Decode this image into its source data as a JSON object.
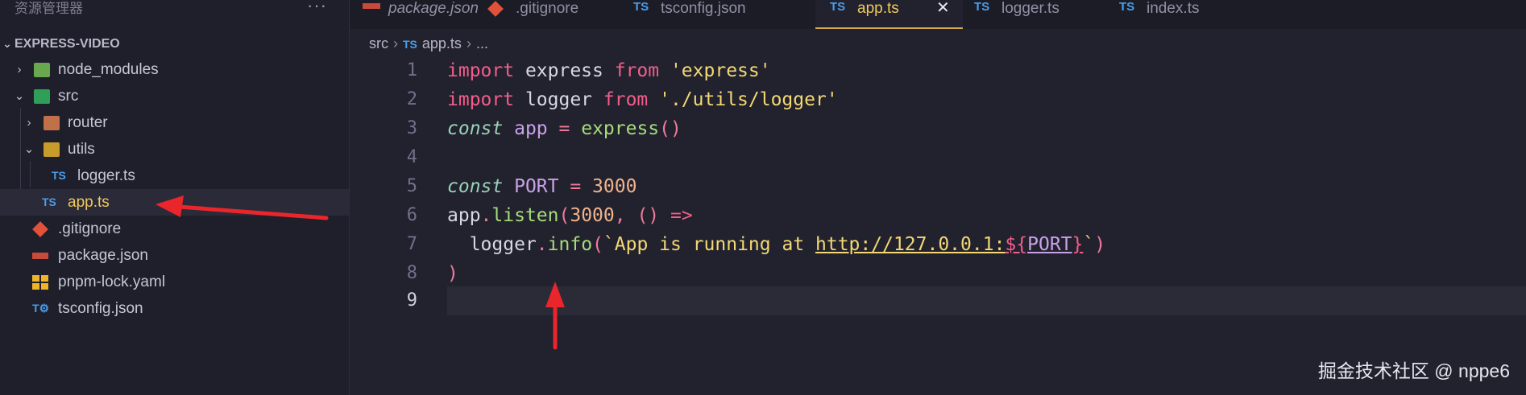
{
  "sidebar": {
    "title": "资源管理器",
    "more_icon": "···",
    "project": "EXPRESS-VIDEO",
    "items": [
      {
        "label": "node_modules",
        "icon": "node-modules-folder-icon"
      },
      {
        "label": "src",
        "icon": "src-folder-icon"
      },
      {
        "label": "router",
        "icon": "router-folder-icon"
      },
      {
        "label": "utils",
        "icon": "utils-folder-icon"
      },
      {
        "label": "logger.ts",
        "icon": "typescript-file-icon"
      },
      {
        "label": "app.ts",
        "icon": "typescript-file-icon"
      },
      {
        "label": ".gitignore",
        "icon": "git-icon"
      },
      {
        "label": "package.json",
        "icon": "npm-package-icon"
      },
      {
        "label": "pnpm-lock.yaml",
        "icon": "pnpm-icon"
      },
      {
        "label": "tsconfig.json",
        "icon": "tsconfig-icon"
      }
    ]
  },
  "tabs": [
    {
      "label": "package.json",
      "icon": "npm-package-icon"
    },
    {
      "label": ".gitignore",
      "icon": "git-icon"
    },
    {
      "label": "tsconfig.json",
      "icon": "tsconfig-icon",
      "icon_text": "TS"
    },
    {
      "label": "app.ts",
      "icon": "typescript-file-icon",
      "icon_text": "TS",
      "active": true
    },
    {
      "label": "logger.ts",
      "icon": "typescript-file-icon",
      "icon_text": "TS"
    },
    {
      "label": "index.ts",
      "icon": "typescript-file-icon",
      "icon_text": "TS"
    }
  ],
  "breadcrumb": {
    "folder": "src",
    "file_icon": "TS",
    "file": "app.ts",
    "rest": "..."
  },
  "editor": {
    "current_line": 9,
    "line_numbers": [
      "1",
      "2",
      "3",
      "4",
      "5",
      "6",
      "7",
      "8",
      "9"
    ],
    "code": {
      "l1": {
        "kw1": "import",
        "id": " express ",
        "kw2": "from",
        "str": " 'express'"
      },
      "l2": {
        "kw1": "import",
        "id": " logger ",
        "kw2": "from",
        "str": " './utils/logger'"
      },
      "l3": {
        "kw": "const",
        "id": " app ",
        "op": "=",
        "fn": " express",
        "paren": "()"
      },
      "l5": {
        "kw": "const",
        "id": " PORT ",
        "op": "= ",
        "num": "3000"
      },
      "l6": {
        "id": "app",
        "dot": ".",
        "fn": "listen",
        "p1": "(",
        "num": "3000",
        "comma": ", ",
        "p2": "() ",
        "arrow": "=>"
      },
      "l7": {
        "indent": "  ",
        "id": "logger",
        "dot": ".",
        "fn": "info",
        "p1": "(",
        "tick": "`",
        "text": "App is running at ",
        "url": "http://127.0.0.1:",
        "interp_open": "${",
        "var": "PORT",
        "interp_close": "}",
        "tick2": "`",
        "p2": ")"
      },
      "l8": {
        "p": ")"
      }
    }
  },
  "watermark": "掘金技术社区 @ nppe6",
  "colors": {
    "arrow": "#e8262b",
    "active_tab": "#f0c95c"
  }
}
